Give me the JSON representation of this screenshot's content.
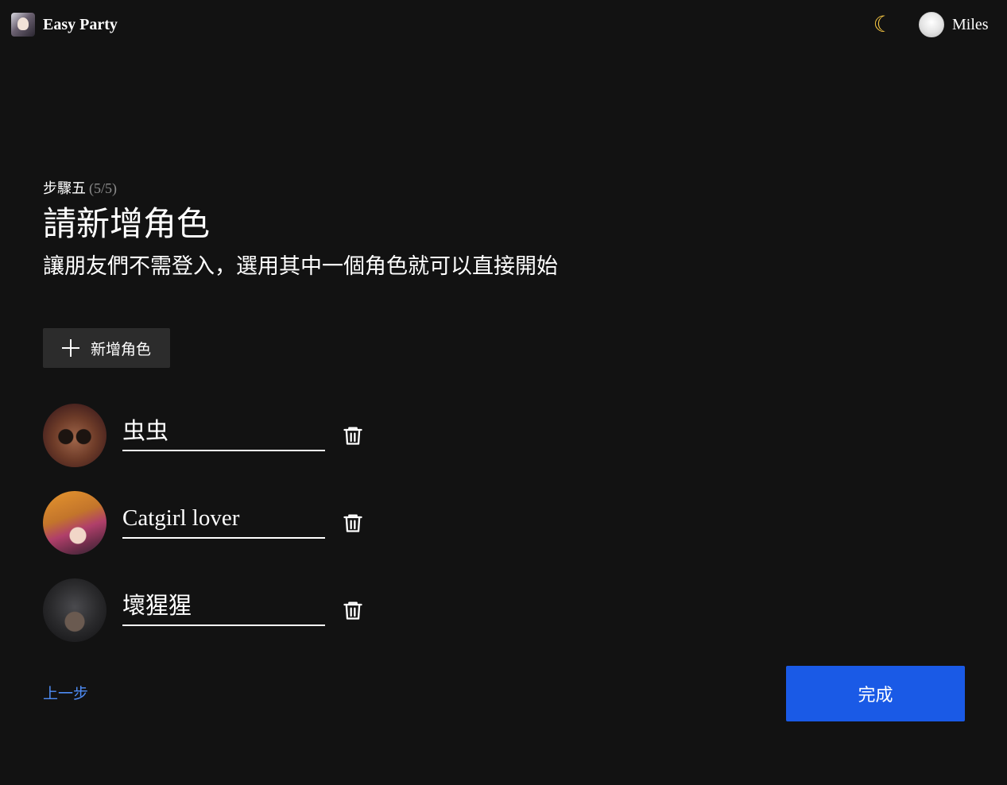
{
  "header": {
    "app_name": "Easy Party",
    "theme_toggle_icon": "moon-icon",
    "user_name": "Miles"
  },
  "step": {
    "label": "步驟五",
    "count": "(5/5)"
  },
  "page": {
    "title": "請新增角色",
    "subtitle": "讓朋友們不需登入，選用其中一個角色就可以直接開始"
  },
  "add_button": {
    "label": "新增角色",
    "icon": "plus-icon"
  },
  "roles": [
    {
      "name": "虫虫",
      "avatar": "spider-avatar",
      "delete_icon": "trash-icon"
    },
    {
      "name": "Catgirl lover",
      "avatar": "catgirl-avatar",
      "delete_icon": "trash-icon"
    },
    {
      "name": "壞猩猩",
      "avatar": "ape-avatar",
      "delete_icon": "trash-icon"
    }
  ],
  "footer": {
    "back_label": "上一步",
    "finish_label": "完成"
  },
  "colors": {
    "background": "#121212",
    "primary": "#1a5ae6",
    "link": "#4e8cf5",
    "button_secondary": "#2c2c2c"
  }
}
